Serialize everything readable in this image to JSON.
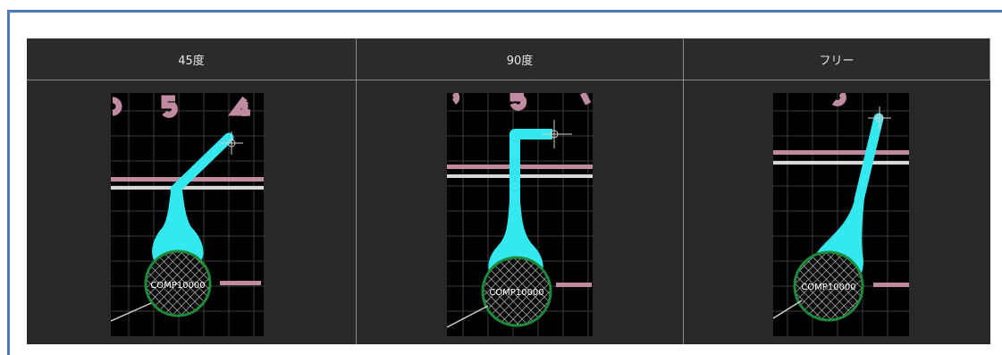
{
  "columns": [
    {
      "label": "45度",
      "mode": "45-degree"
    },
    {
      "label": "90度",
      "mode": "90-degree"
    },
    {
      "label": "フリー",
      "mode": "free"
    }
  ],
  "pad_label": "COMP10000",
  "colors": {
    "frame_border": "#4a7ab8",
    "panel_bg": "#262626",
    "canvas_bg": "#000000",
    "trace": "#33e8ee",
    "pad_ring": "#1f8a3a",
    "silk": "#c08aa0",
    "grid": "#3c3c3c"
  },
  "icons": {
    "hatch": "cross-hatch-pattern",
    "cursor": "crosshair-icon"
  }
}
